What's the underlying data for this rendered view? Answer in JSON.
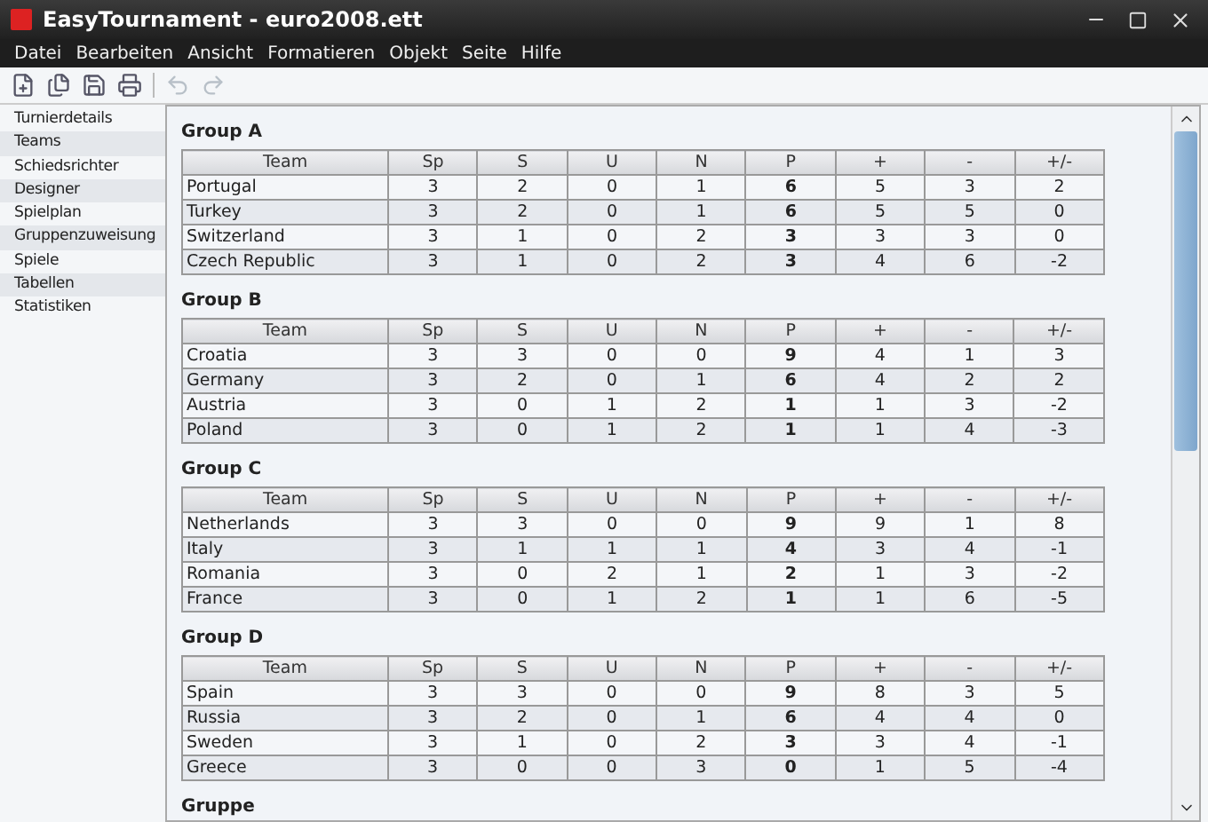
{
  "window": {
    "title": "EasyTournament - euro2008.ett"
  },
  "menu": [
    "Datei",
    "Bearbeiten",
    "Ansicht",
    "Formatieren",
    "Objekt",
    "Seite",
    "Hilfe"
  ],
  "toolbar": [
    {
      "kind": "new",
      "disabled": false
    },
    {
      "kind": "open",
      "disabled": false
    },
    {
      "kind": "save",
      "disabled": false
    },
    {
      "kind": "print",
      "disabled": false
    },
    {
      "kind": "undo",
      "disabled": true
    },
    {
      "kind": "redo",
      "disabled": true
    }
  ],
  "sidebar": {
    "items": [
      "Turnierdetails",
      "Teams",
      "Schiedsrichter",
      "Designer",
      "Spielplan",
      "Gruppenzuweisung",
      "Spiele",
      "Tabellen",
      "Statistiken"
    ]
  },
  "groups": [
    {
      "title": "Group A",
      "columns": [
        "Team",
        "Sp",
        "S",
        "U",
        "N",
        "P",
        "+",
        "-",
        "+/-"
      ],
      "rows": [
        [
          "Portugal",
          "3",
          "2",
          "0",
          "1",
          "6",
          "5",
          "3",
          "2"
        ],
        [
          "Turkey",
          "3",
          "2",
          "0",
          "1",
          "6",
          "5",
          "5",
          "0"
        ],
        [
          "Switzerland",
          "3",
          "1",
          "0",
          "2",
          "3",
          "3",
          "3",
          "0"
        ],
        [
          "Czech Republic",
          "3",
          "1",
          "0",
          "2",
          "3",
          "4",
          "6",
          "-2"
        ]
      ]
    },
    {
      "title": "Group B",
      "columns": [
        "Team",
        "Sp",
        "S",
        "U",
        "N",
        "P",
        "+",
        "-",
        "+/-"
      ],
      "rows": [
        [
          "Croatia",
          "3",
          "3",
          "0",
          "0",
          "9",
          "4",
          "1",
          "3"
        ],
        [
          "Germany",
          "3",
          "2",
          "0",
          "1",
          "6",
          "4",
          "2",
          "2"
        ],
        [
          "Austria",
          "3",
          "0",
          "1",
          "2",
          "1",
          "1",
          "3",
          "-2"
        ],
        [
          "Poland",
          "3",
          "0",
          "1",
          "2",
          "1",
          "1",
          "4",
          "-3"
        ]
      ]
    },
    {
      "title": "Group C",
      "columns": [
        "Team",
        "Sp",
        "S",
        "U",
        "N",
        "P",
        "+",
        "-",
        "+/-"
      ],
      "rows": [
        [
          "Netherlands",
          "3",
          "3",
          "0",
          "0",
          "9",
          "9",
          "1",
          "8"
        ],
        [
          "Italy",
          "3",
          "1",
          "1",
          "1",
          "4",
          "3",
          "4",
          "-1"
        ],
        [
          "Romania",
          "3",
          "0",
          "2",
          "1",
          "2",
          "1",
          "3",
          "-2"
        ],
        [
          "France",
          "3",
          "0",
          "1",
          "2",
          "1",
          "1",
          "6",
          "-5"
        ]
      ]
    },
    {
      "title": "Group D",
      "columns": [
        "Team",
        "Sp",
        "S",
        "U",
        "N",
        "P",
        "+",
        "-",
        "+/-"
      ],
      "rows": [
        [
          "Spain",
          "3",
          "3",
          "0",
          "0",
          "9",
          "8",
          "3",
          "5"
        ],
        [
          "Russia",
          "3",
          "2",
          "0",
          "1",
          "6",
          "4",
          "4",
          "0"
        ],
        [
          "Sweden",
          "3",
          "1",
          "0",
          "2",
          "3",
          "3",
          "4",
          "-1"
        ],
        [
          "Greece",
          "3",
          "0",
          "0",
          "3",
          "0",
          "1",
          "5",
          "-4"
        ]
      ]
    },
    {
      "title": "Gruppe"
    }
  ]
}
